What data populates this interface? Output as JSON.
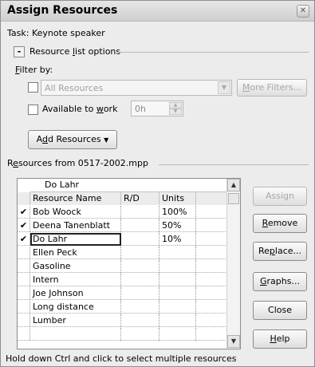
{
  "title": "Assign Resources",
  "close_glyph": "✕",
  "task_label": "Task: Keynote speaker",
  "resource_list_options": {
    "toggle": "-",
    "label_pre": "Resource ",
    "label_u": "l",
    "label_post": "ist options"
  },
  "filter": {
    "label_u": "F",
    "label_post": "ilter by:",
    "value": "All Resources",
    "more_filters_u": "M",
    "more_filters_post": "ore Filters..."
  },
  "available": {
    "label_pre": "Available to ",
    "label_u": "w",
    "label_post": "ork",
    "value": "0h"
  },
  "add_resources": {
    "label_pre": "A",
    "label_u": "d",
    "label_post": "d Resources",
    "arrow": "▼"
  },
  "resources_from": {
    "label_pre": "R",
    "label_u": "e",
    "label_post": "sources from 0517-2002.mpp"
  },
  "grid": {
    "edit_value": "Do Lahr",
    "columns": [
      "Resource Name",
      "R/D",
      "Units"
    ],
    "rows": [
      {
        "check": "✔",
        "name": "Bob Woock",
        "rd": "",
        "units": "100%"
      },
      {
        "check": "✔",
        "name": "Deena Tanenblatt",
        "rd": "",
        "units": "50%"
      },
      {
        "check": "✔",
        "name": "Do Lahr",
        "rd": "",
        "units": "10%"
      },
      {
        "check": "",
        "name": "Ellen Peck",
        "rd": "",
        "units": ""
      },
      {
        "check": "",
        "name": "Gasoline",
        "rd": "",
        "units": ""
      },
      {
        "check": "",
        "name": "Intern",
        "rd": "",
        "units": ""
      },
      {
        "check": "",
        "name": "Joe Johnson",
        "rd": "",
        "units": ""
      },
      {
        "check": "",
        "name": "Long distance",
        "rd": "",
        "units": ""
      },
      {
        "check": "",
        "name": "Lumber",
        "rd": "",
        "units": ""
      },
      {
        "check": "",
        "name": "",
        "rd": "",
        "units": ""
      }
    ]
  },
  "buttons": {
    "assign": "Assign",
    "remove_u": "R",
    "remove_post": "emove",
    "replace_pre": "Re",
    "replace_u": "p",
    "replace_post": "lace...",
    "graphs_u": "G",
    "graphs_post": "raphs...",
    "close": "Close",
    "help_u": "H",
    "help_post": "elp"
  },
  "footer": "Hold down Ctrl and click to select multiple resources"
}
